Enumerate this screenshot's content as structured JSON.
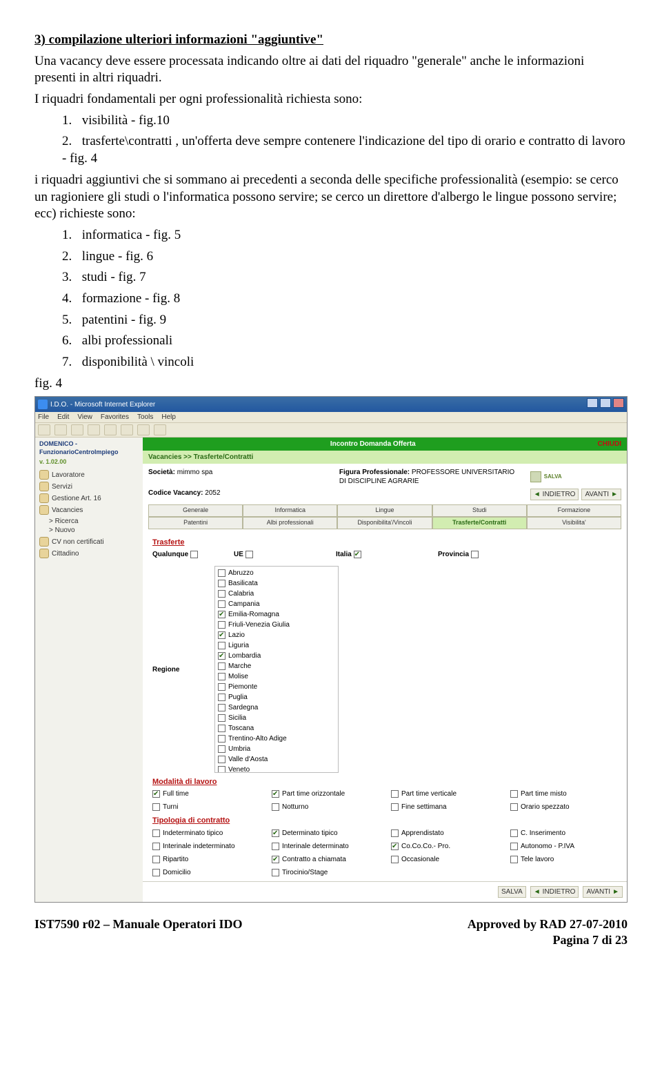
{
  "sect_title": "3) compilazione ulteriori informazioni \"aggiuntive\"",
  "p1": "Una vacancy deve essere processata indicando oltre ai dati del riquadro \"generale\" anche le informazioni presenti in altri riquadri.",
  "p2": "I riquadri fondamentali per ogni professionalità richiesta sono:",
  "ol1": [
    "visibilità  - fig.10",
    "trasferte\\contratti , un'offerta deve sempre contenere l'indicazione del tipo di orario e contratto di lavoro - fig. 4"
  ],
  "p3": "i riquadri aggiuntivi che si sommano ai precedenti a seconda delle specifiche professionalità (esempio: se cerco un ragioniere gli studi o l'informatica possono servire; se cerco un direttore d'albergo le lingue possono servire; ecc) richieste sono:",
  "ol2": [
    "informatica - fig. 5",
    "lingue  - fig. 6",
    "studi  - fig. 7",
    "formazione - fig. 8",
    "patentini - fig. 9",
    "albi professionali",
    "disponibilità \\ vincoli"
  ],
  "fig_label": "fig. 4",
  "browser": {
    "title": "I.D.O. - Microsoft Internet Explorer",
    "menu": [
      "File",
      "Edit",
      "View",
      "Favorites",
      "Tools",
      "Help"
    ]
  },
  "app": {
    "operator": "DOMENICO - FunzionarioCentroImpiego",
    "version": "v. 1.02.00",
    "nav": [
      "Lavoratore",
      "Servizi",
      "Gestione Art. 16",
      "Vacancies",
      "CV non certificati",
      "Cittadino"
    ],
    "navsub": [
      "> Ricerca",
      "> Nuovo"
    ],
    "header_center": "Incontro Domanda Offerta",
    "header_right": "CHIUDI",
    "sub_crumb": "Vacancies >> Trasferte/Contratti",
    "info": {
      "societa_lbl": "Società:",
      "societa": "mimmo spa",
      "codice_lbl": "Codice Vacancy:",
      "codice": "2052",
      "figura_lbl": "Figura Professionale:",
      "figura": "PROFESSORE UNIVERSITARIO DI DISCIPLINE AGRARIE",
      "salva": "SALVA",
      "indietro": "INDIETRO",
      "avanti": "AVANTI"
    },
    "tabs_row1": [
      "Generale",
      "Informatica",
      "Lingue",
      "Studi",
      "Formazione"
    ],
    "tabs_row2": [
      "Patentini",
      "Albi professionali",
      "Disponibilita'/Vincoli",
      "Trasferte/Contratti",
      "Visibilita'"
    ],
    "tabs_selected": "Trasferte/Contratti",
    "sect_trasferte": "Trasferte",
    "geo_labels": {
      "qualunque": "Qualunque",
      "ue": "UE",
      "italia": "Italia",
      "provincia": "Provincia",
      "regione": "Regione"
    },
    "geo_checked": {
      "qualunque": false,
      "ue": false,
      "italia": true,
      "provincia": false
    },
    "regions": [
      {
        "name": "Abruzzo",
        "checked": false
      },
      {
        "name": "Basilicata",
        "checked": false
      },
      {
        "name": "Calabria",
        "checked": false
      },
      {
        "name": "Campania",
        "checked": false
      },
      {
        "name": "Emilia-Romagna",
        "checked": true
      },
      {
        "name": "Friuli-Venezia Giulia",
        "checked": false
      },
      {
        "name": "Lazio",
        "checked": true
      },
      {
        "name": "Liguria",
        "checked": false
      },
      {
        "name": "Lombardia",
        "checked": true
      },
      {
        "name": "Marche",
        "checked": false
      },
      {
        "name": "Molise",
        "checked": false
      },
      {
        "name": "Piemonte",
        "checked": false
      },
      {
        "name": "Puglia",
        "checked": false
      },
      {
        "name": "Sardegna",
        "checked": false
      },
      {
        "name": "Sicilia",
        "checked": false
      },
      {
        "name": "Toscana",
        "checked": false
      },
      {
        "name": "Trentino-Alto Adige",
        "checked": false
      },
      {
        "name": "Umbria",
        "checked": false
      },
      {
        "name": "Valle d'Aosta",
        "checked": false
      },
      {
        "name": "Veneto",
        "checked": false
      }
    ],
    "sect_modalita": "Modalità di lavoro",
    "modalita": [
      {
        "name": "Full time",
        "checked": true
      },
      {
        "name": "Part time orizzontale",
        "checked": true
      },
      {
        "name": "Part time verticale",
        "checked": false
      },
      {
        "name": "Part time misto",
        "checked": false
      },
      {
        "name": "Turni",
        "checked": false
      },
      {
        "name": "Notturno",
        "checked": false
      },
      {
        "name": "Fine settimana",
        "checked": false
      },
      {
        "name": "Orario spezzato",
        "checked": false
      }
    ],
    "sect_tipologia": "Tipologia di contratto",
    "tipologia": [
      {
        "name": "Indeterminato tipico",
        "checked": false
      },
      {
        "name": "Determinato tipico",
        "checked": true
      },
      {
        "name": "Apprendistato",
        "checked": false
      },
      {
        "name": "C. Inserimento",
        "checked": false
      },
      {
        "name": "Interinale indeterminato",
        "checked": false
      },
      {
        "name": "Interinale determinato",
        "checked": false
      },
      {
        "name": "Co.Co.Co.- Pro.",
        "checked": true
      },
      {
        "name": "Autonomo - P.IVA",
        "checked": false
      },
      {
        "name": "Ripartito",
        "checked": false
      },
      {
        "name": "Contratto a chiamata",
        "checked": true
      },
      {
        "name": "Occasionale",
        "checked": false
      },
      {
        "name": "Tele lavoro",
        "checked": false
      },
      {
        "name": "Domicilio",
        "checked": false
      },
      {
        "name": "Tirocinio/Stage",
        "checked": false
      }
    ]
  },
  "footer": {
    "left": "IST7590 r02 – Manuale Operatori IDO",
    "right": "Approved by RAD 27-07-2010",
    "page": "Pagina 7 di 23"
  }
}
